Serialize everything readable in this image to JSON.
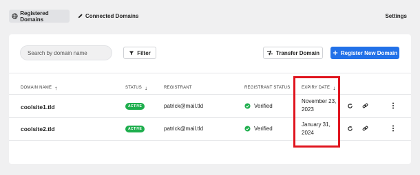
{
  "topnav": {
    "tabs": [
      {
        "label": "Registered Domains",
        "icon": "globe-icon"
      },
      {
        "label": "Connected Domains",
        "icon": "pen-icon"
      }
    ],
    "settings_label": "Settings"
  },
  "toolbar": {
    "search_placeholder": "Search by domain name",
    "filter_label": "Filter",
    "transfer_label": "Transfer Domain",
    "register_label": "Register New Domain"
  },
  "table": {
    "columns": {
      "domain_name": "DOMAIN NAME",
      "status": "STATUS",
      "registrant": "REGISTRANT",
      "registrant_status": "REGISTRANT STATUS",
      "expiry_date": "EXPIRY DATE"
    },
    "rows": [
      {
        "domain": "coolsite1.tld",
        "status": "ACTIVE",
        "registrant": "patrick@mail.tld",
        "registrant_status": "Verified",
        "expiry_line1": "November 23,",
        "expiry_line2": "2023"
      },
      {
        "domain": "coolsite2.tld",
        "status": "ACTIVE",
        "registrant": "patrick@mail.tld",
        "registrant_status": "Verified",
        "expiry_line1": "January 31,",
        "expiry_line2": "2024"
      }
    ]
  },
  "colors": {
    "accent": "#2271e8",
    "active_badge": "#1eae4d",
    "verified": "#1eae4d",
    "highlight": "#e0141e"
  }
}
